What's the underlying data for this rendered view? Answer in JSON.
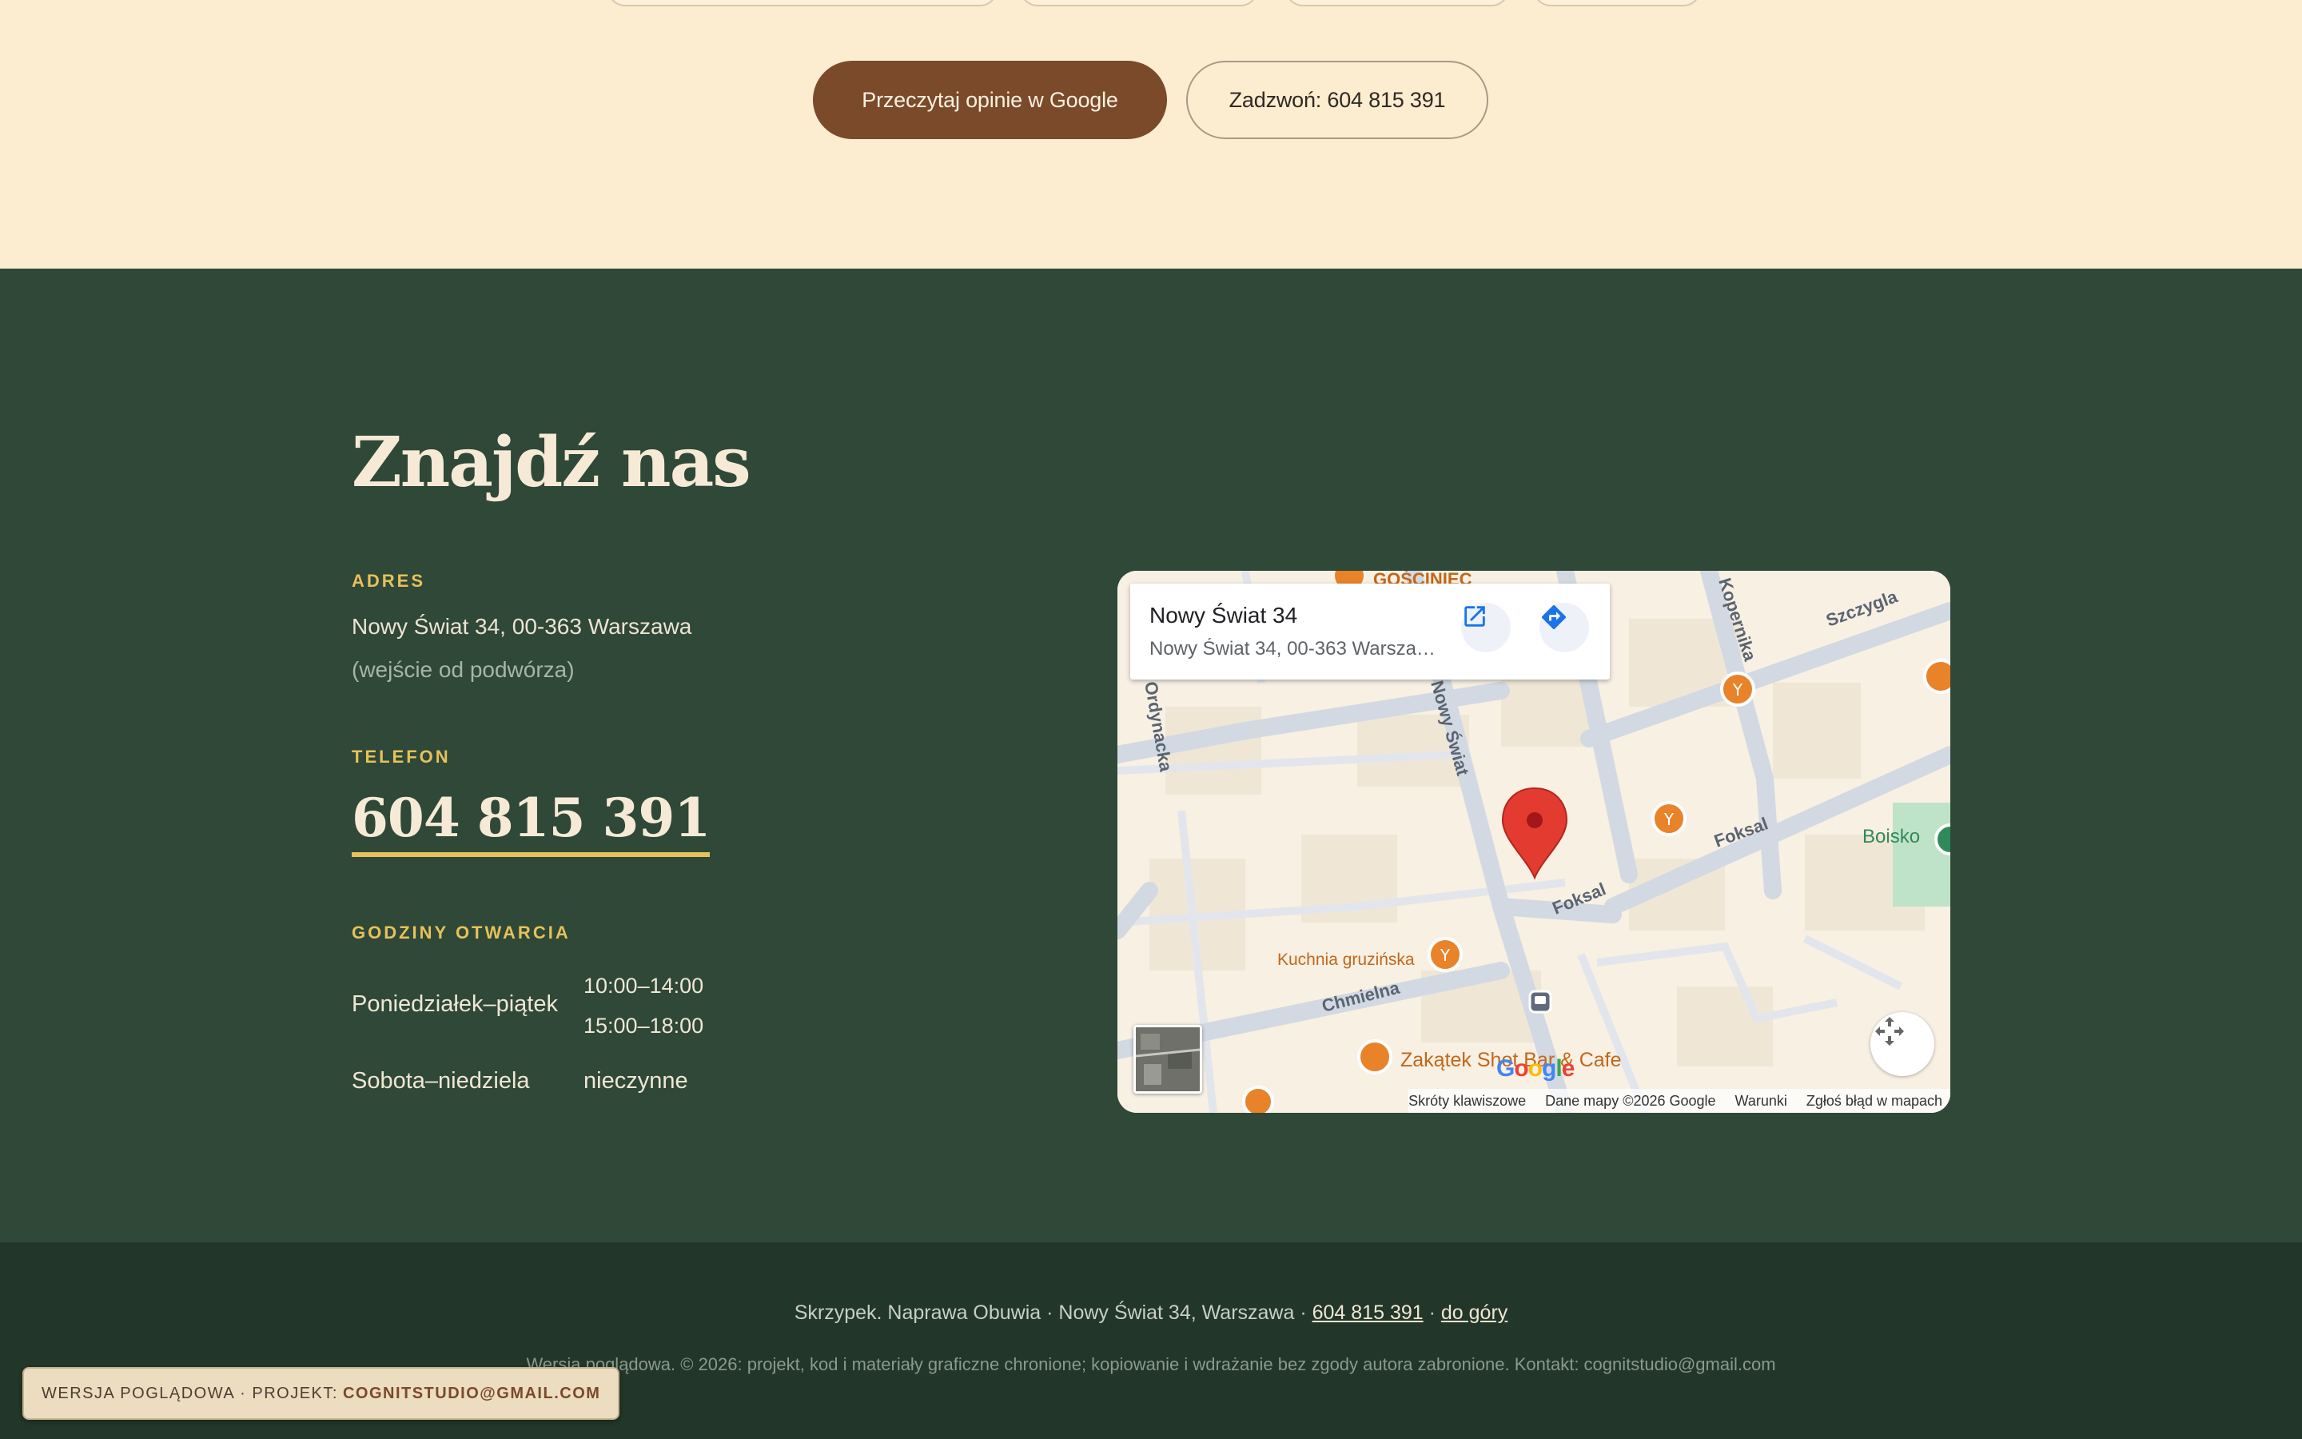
{
  "reviews": {
    "google_button": "Przeczytaj opinie w Google",
    "call_button": "Zadzwoń: 604 815 391"
  },
  "find_us": {
    "heading": "Znajdź nas",
    "address_label": "ADRES",
    "address": "Nowy Świat 34, 00-363 Warszawa",
    "address_note": "(wejście od podwórza)",
    "phone_label": "TELEFON",
    "phone": "604 815 391",
    "hours_label": "GODZINY OTWARCIA",
    "hours": [
      {
        "days": "Poniedziałek–piątek",
        "times": [
          "10:00–14:00",
          "15:00–18:00"
        ]
      },
      {
        "days": "Sobota–niedziela",
        "times": [
          "nieczynne"
        ]
      }
    ]
  },
  "map": {
    "place_title": "Nowy Świat 34",
    "place_address": "Nowy Świat 34, 00-363 Warszawa",
    "streets": [
      "Szczygla",
      "Nowy Świat",
      "Foksal",
      "Foksal",
      "Chmielna",
      "Kopernika",
      "Ordynacka"
    ],
    "pois": [
      "GOŚCINIEC",
      "Kuchnia gruzińska",
      "Zakątek Shot Bar & Cafe",
      "Boisko"
    ],
    "google_logo": "Google",
    "attribution": {
      "shortcuts": "Skróty klawiszowe",
      "data": "Dane mapy ©2026 Google",
      "terms": "Warunki",
      "report": "Zgłoś błąd w mapach"
    },
    "icons": [
      "open-in-new-icon",
      "directions-icon",
      "fullscreen-icon",
      "map-pin-icon",
      "restaurant-icon",
      "bar-icon",
      "bus-stop-icon"
    ]
  },
  "footer": {
    "line1_text": "Skrzypek. Naprawa Obuwia · Nowy Świat 34, Warszawa ·",
    "phone_link": "604 815 391",
    "sep": "·",
    "top_link": "do góry",
    "line2": "Wersja poglądowa. © 2026: projekt, kod i materiały graficzne chronione; kopiowanie i wdrażanie bez zgody autora zabronione. Kontakt: cognitstudio@gmail.com"
  },
  "badge": {
    "prefix": "WERSJA POGLĄDOWA · PROJEKT:",
    "email": "COGNITSTUDIO@GMAIL.COM"
  },
  "colors": {
    "cream": "#fcecd0",
    "brown": "#7a4a2a",
    "forest": "#2f4838",
    "footer": "#223629",
    "gold": "#e7c15a"
  }
}
